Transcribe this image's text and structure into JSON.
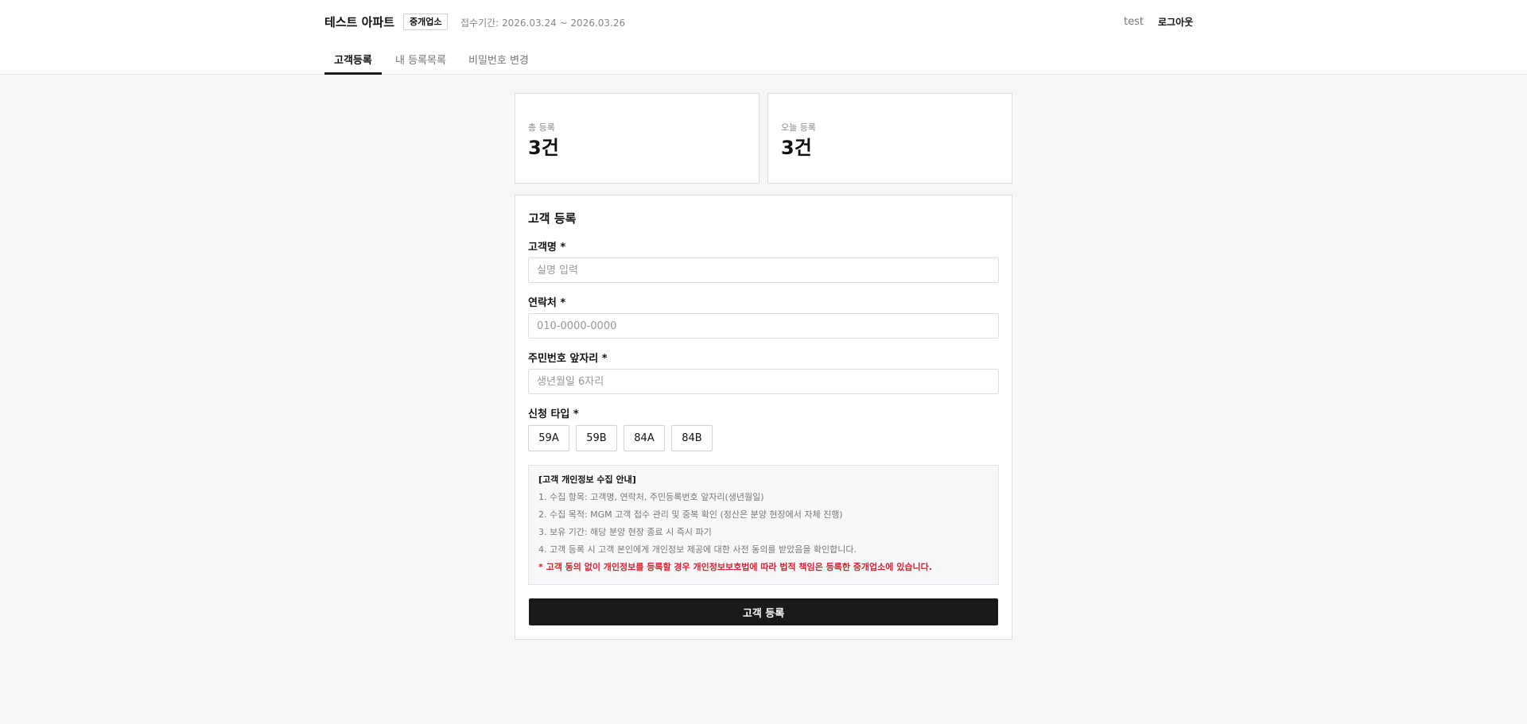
{
  "header": {
    "brand": "테스트 아파트",
    "badge": "중개업소",
    "period": "접수기간: 2026.03.24 ~ 2026.03.26",
    "user": "test",
    "logout_label": "로그아웃"
  },
  "tabs": [
    {
      "label": "고객등록",
      "active": true
    },
    {
      "label": "내 등록목록",
      "active": false
    },
    {
      "label": "비밀번호 변경",
      "active": false
    }
  ],
  "stats": [
    {
      "label": "총 등록",
      "value": "3건"
    },
    {
      "label": "오늘 등록",
      "value": "3건"
    }
  ],
  "form": {
    "title": "고객 등록",
    "name_label": "고객명 *",
    "name_placeholder": "실명 입력",
    "phone_label": "연락처 *",
    "phone_placeholder": "010-0000-0000",
    "rrn_label": "주민번호 앞자리 *",
    "rrn_placeholder": "생년월일 6자리",
    "type_label": "신청 타입 *",
    "types": [
      "59A",
      "59B",
      "84A",
      "84B"
    ],
    "submit_label": "고객 등록"
  },
  "notice": {
    "title": "[고객 개인정보 수집 안내]",
    "lines": [
      "1. 수집 항목: 고객명, 연락처, 주민등록번호 앞자리(생년월일)",
      "2. 수집 목적: MGM 고객 접수 관리 및 중복 확인 (정산은 분양 현장에서 자체 진행)",
      "3. 보유 기간: 해당 분양 현장 종료 시 즉시 파기",
      "4. 고객 등록 시 고객 본인에게 개인정보 제공에 대한 사전 동의를 받았음을 확인합니다."
    ],
    "warning": "* 고객 동의 없이 개인정보를 등록할 경우 개인정보보호법에 따라 법적 책임은 등록한 중개업소에 있습니다."
  },
  "colors": {
    "accent": "#1a1a1a",
    "warning": "#e0202f",
    "background": "#f6f7f9"
  }
}
